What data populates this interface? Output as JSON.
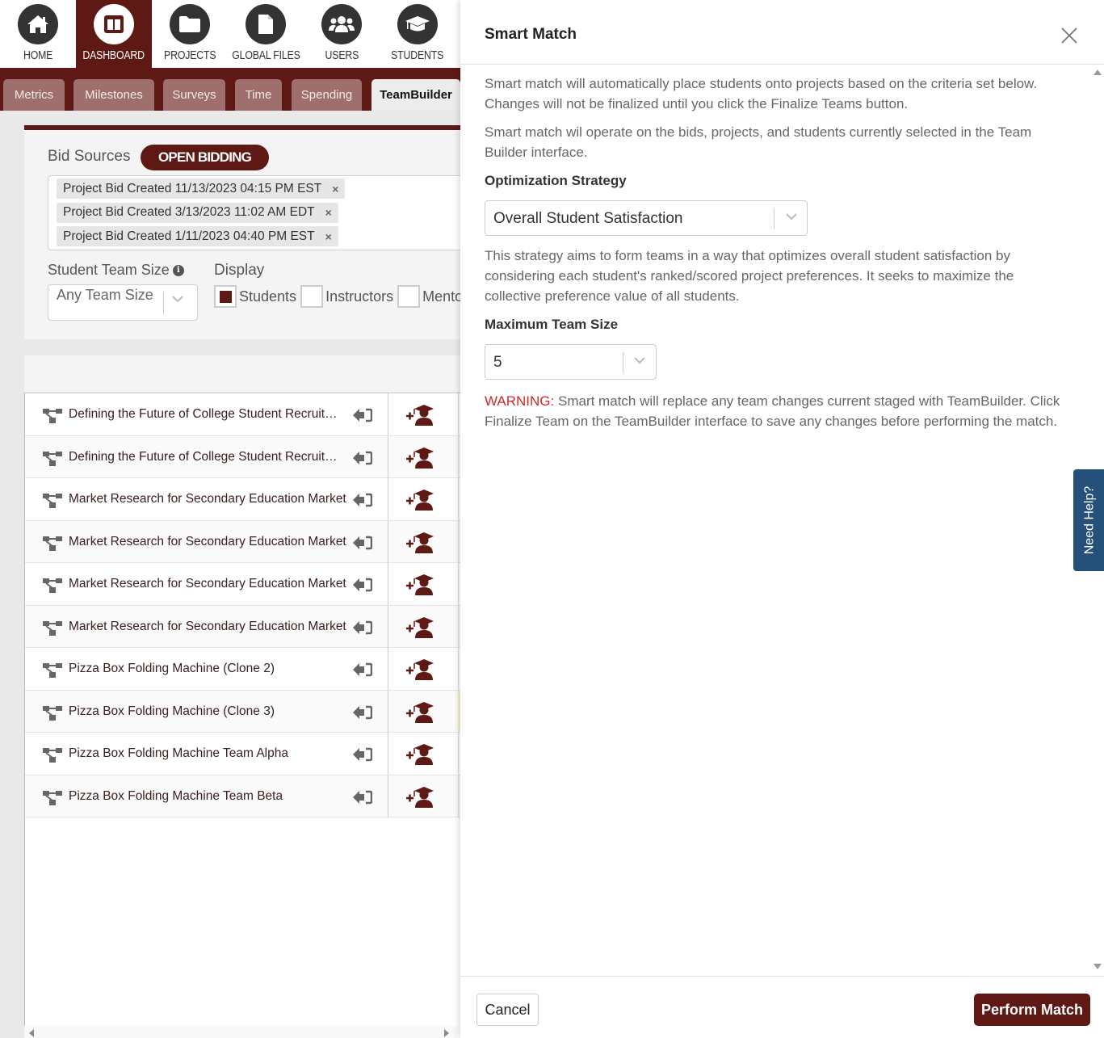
{
  "topnav": {
    "items": [
      {
        "label": "HOME",
        "icon": "home-icon"
      },
      {
        "label": "DASHBOARD",
        "icon": "dashboard-icon",
        "active": true
      },
      {
        "label": "PROJECTS",
        "icon": "folder-icon"
      },
      {
        "label": "GLOBAL FILES",
        "icon": "file-icon"
      },
      {
        "label": "USERS",
        "icon": "users-icon"
      },
      {
        "label": "STUDENTS",
        "icon": "graduation-cap-icon"
      }
    ]
  },
  "tabs": [
    {
      "label": "Metrics"
    },
    {
      "label": "Milestones"
    },
    {
      "label": "Surveys"
    },
    {
      "label": "Time"
    },
    {
      "label": "Spending"
    },
    {
      "label": "TeamBuilder",
      "active": true
    }
  ],
  "filters": {
    "bid_sources_label": "Bid Sources",
    "open_bidding_label": "OPEN BIDDING",
    "bid_chips": [
      "Project Bid Created 11/13/2023 04:15 PM EST",
      "Project Bid Created 3/13/2023 11:02 AM EDT",
      "Project Bid Created 1/11/2023 04:40 PM EST"
    ],
    "chip_remove": "×",
    "team_size_label": "Student Team Size",
    "team_size_value": "Any Team Size",
    "display_label": "Display",
    "display_options": [
      {
        "label": "Students",
        "checked": true
      },
      {
        "label": "Instructors",
        "checked": false
      },
      {
        "label": "Mentors",
        "checked": false
      }
    ]
  },
  "projects": [
    {
      "name": "Defining the Future of College Student Recruitment"
    },
    {
      "name": "Defining the Future of College Student Recruitment"
    },
    {
      "name": "Market Research for Secondary Education Market"
    },
    {
      "name": "Market Research for Secondary Education Market"
    },
    {
      "name": "Market Research for Secondary Education Market"
    },
    {
      "name": "Market Research for Secondary Education Market"
    },
    {
      "name": "Pizza Box Folding Machine (Clone 2)"
    },
    {
      "name": "Pizza Box Folding Machine (Clone 3)",
      "highlighted": true
    },
    {
      "name": "Pizza Box Folding Machine Team Alpha"
    },
    {
      "name": "Pizza Box Folding Machine Team Beta"
    }
  ],
  "modal": {
    "title": "Smart Match",
    "intro_1": "Smart match will automatically place students onto projects based on the criteria set below. Changes will not be finalized until you click the Finalize Teams button.",
    "intro_2": "Smart match wil operate on the bids, projects, and students currently selected in the Team Builder interface.",
    "strategy_label": "Optimization Strategy",
    "strategy_value": "Overall Student Satisfaction",
    "strategy_description": "This strategy aims to form teams in a way that optimizes overall student satisfaction by considering each student's ranked/scored project preferences. It seeks to maximize the collective preference value of all students.",
    "max_size_label": "Maximum Team Size",
    "max_size_value": "5",
    "warning_prefix": "WARNING:",
    "warning_text": " Smart match will replace any team changes current staged with TeamBuilder. Click Finalize Team on the TeamBuilder interface to save any changes before performing the match.",
    "cancel_label": "Cancel",
    "perform_label": "Perform Match"
  },
  "need_help_label": "Need Help?",
  "colors": {
    "brand": "#5e1914",
    "warning": "#d0262d",
    "help": "#24507a"
  }
}
